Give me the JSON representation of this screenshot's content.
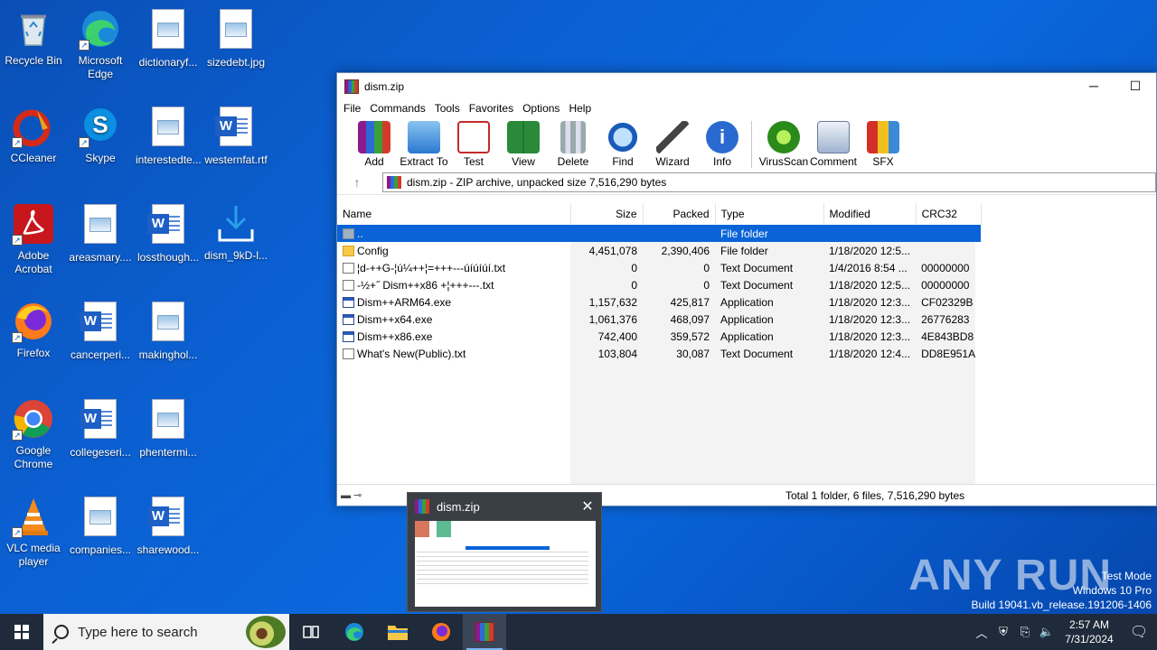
{
  "desktop": {
    "icons": [
      {
        "label": "Recycle Bin"
      },
      {
        "label": "Microsoft Edge"
      },
      {
        "label": "dictionaryf..."
      },
      {
        "label": "sizedebt.jpg"
      },
      {
        "label": "CCleaner"
      },
      {
        "label": "Skype"
      },
      {
        "label": "interestedte..."
      },
      {
        "label": "westernfat.rtf"
      },
      {
        "label": "Adobe Acrobat"
      },
      {
        "label": "areasmary...."
      },
      {
        "label": "lossthough..."
      },
      {
        "label": "dism_9kD-l..."
      },
      {
        "label": "Firefox"
      },
      {
        "label": "cancerperi..."
      },
      {
        "label": "makinghol..."
      },
      {
        "label": "Google Chrome"
      },
      {
        "label": "collegeseri..."
      },
      {
        "label": "phentermi..."
      },
      {
        "label": "VLC media player"
      },
      {
        "label": "companies..."
      },
      {
        "label": "sharewood..."
      }
    ]
  },
  "window": {
    "title": "dism.zip",
    "minimize": "─",
    "maximize": "☐",
    "menu": [
      "File",
      "Commands",
      "Tools",
      "Favorites",
      "Options",
      "Help"
    ],
    "toolbar": [
      "Add",
      "Extract To",
      "Test",
      "View",
      "Delete",
      "Find",
      "Wizard",
      "Info",
      "VirusScan",
      "Comment",
      "SFX"
    ],
    "address": "dism.zip - ZIP archive, unpacked size 7,516,290 bytes",
    "columns": {
      "name": "Name",
      "size": "Size",
      "packed": "Packed",
      "type": "Type",
      "modified": "Modified",
      "crc": "CRC32"
    },
    "rows": [
      {
        "name": "..",
        "size": "",
        "packed": "",
        "type": "File folder",
        "modified": "",
        "crc": "",
        "icon": "up"
      },
      {
        "name": "Config",
        "size": "4,451,078",
        "packed": "2,390,406",
        "type": "File folder",
        "modified": "1/18/2020 12:5...",
        "crc": "",
        "icon": "folder"
      },
      {
        "name": "¦d-++G-¦ú¼++¦=+++---úíúíúí.txt",
        "size": "0",
        "packed": "0",
        "type": "Text Document",
        "modified": "1/4/2016 8:54 ...",
        "crc": "00000000",
        "icon": "txt"
      },
      {
        "name": "-½+˝ Dism++x86 +¦+++---.txt",
        "size": "0",
        "packed": "0",
        "type": "Text Document",
        "modified": "1/18/2020 12:5...",
        "crc": "00000000",
        "icon": "txt"
      },
      {
        "name": "Dism++ARM64.exe",
        "size": "1,157,632",
        "packed": "425,817",
        "type": "Application",
        "modified": "1/18/2020 12:3...",
        "crc": "CF02329B",
        "icon": "exe"
      },
      {
        "name": "Dism++x64.exe",
        "size": "1,061,376",
        "packed": "468,097",
        "type": "Application",
        "modified": "1/18/2020 12:3...",
        "crc": "26776283",
        "icon": "exe"
      },
      {
        "name": "Dism++x86.exe",
        "size": "742,400",
        "packed": "359,572",
        "type": "Application",
        "modified": "1/18/2020 12:3...",
        "crc": "4E843BD8",
        "icon": "exe"
      },
      {
        "name": "What's New(Public).txt",
        "size": "103,804",
        "packed": "30,087",
        "type": "Text Document",
        "modified": "1/18/2020 12:4...",
        "crc": "DD8E951A",
        "icon": "txt"
      }
    ],
    "status": "Total 1 folder, 6 files, 7,516,290 bytes"
  },
  "thumbnail": {
    "title": "dism.zip",
    "close": "✕"
  },
  "watermark": {
    "text": "ANY RUN",
    "mode": "Test Mode",
    "os": "Windows 10 Pro",
    "build": "Build 19041.vb_release.191206-1406"
  },
  "taskbar": {
    "search_placeholder": "Type here to search",
    "time": "2:57 AM",
    "date": "7/31/2024"
  }
}
